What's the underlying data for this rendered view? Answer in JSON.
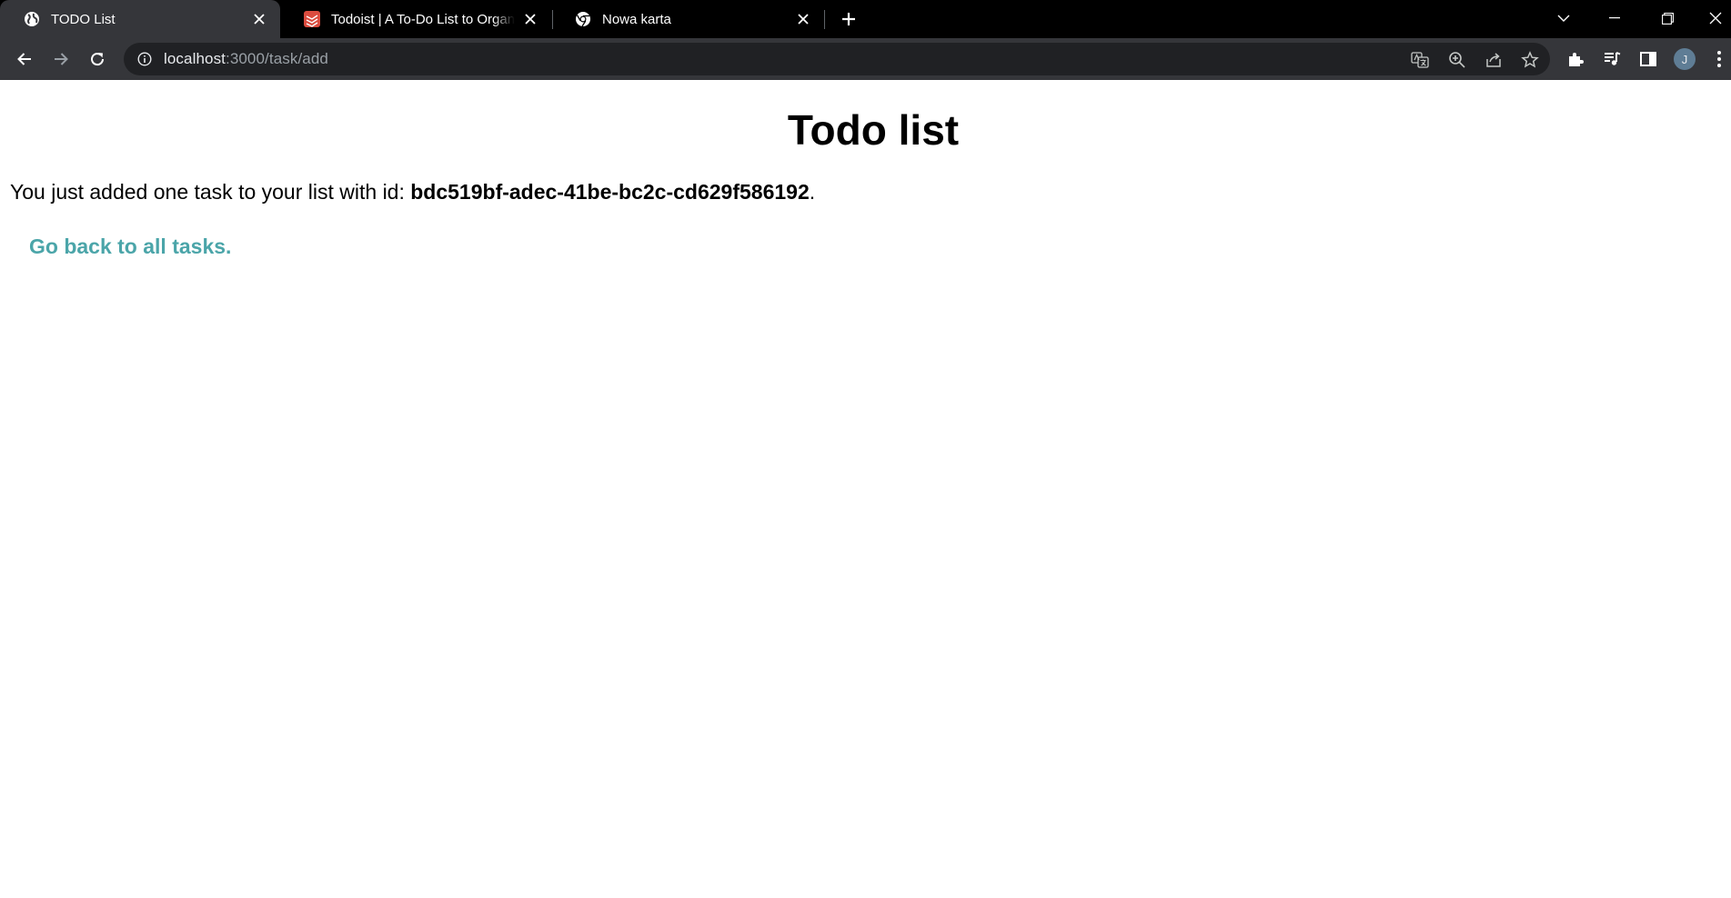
{
  "browser": {
    "tabs": [
      {
        "title": "TODO List",
        "active": true,
        "icon": "globe-icon"
      },
      {
        "title": "Todoist | A To-Do List to Organize Your Work & Life",
        "active": false,
        "icon": "todoist-icon"
      },
      {
        "title": "Nowa karta",
        "active": false,
        "icon": "chrome-icon"
      }
    ],
    "address": {
      "host": "localhost",
      "path": ":3000/task/add"
    },
    "profile_initial": "J",
    "colors": {
      "tabbar": "#000000",
      "toolbar": "#35363a",
      "omnibox": "#202124",
      "todoist_red": "#db4c3f"
    }
  },
  "page": {
    "heading": "Todo list",
    "message_prefix": "You just added one task to your list with id: ",
    "task_id": "bdc519bf-adec-41be-bc2c-cd629f586192",
    "message_suffix": ".",
    "back_link": "Go back to all tasks.",
    "link_color": "#4ba5a9"
  }
}
